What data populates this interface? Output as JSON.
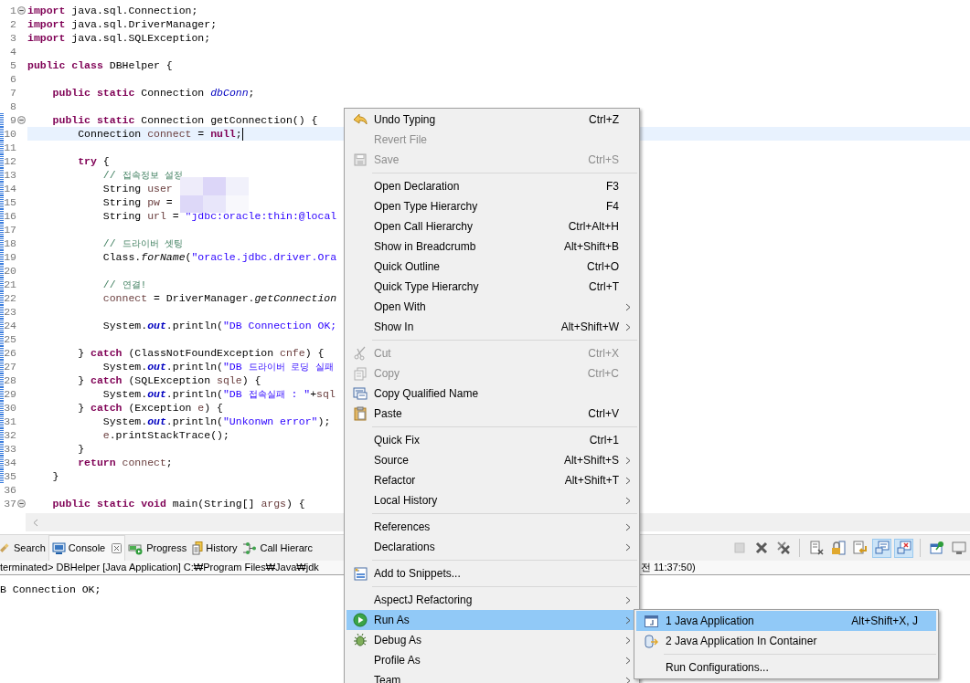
{
  "editor": {
    "lines": [
      {
        "n": "1",
        "fold": true,
        "current": false,
        "changed": false,
        "tokens": [
          {
            "kind": "keyword",
            "text": "import"
          },
          {
            "kind": "plain",
            "text": " java.sql.Connection;"
          }
        ]
      },
      {
        "n": "2",
        "fold": false,
        "current": false,
        "changed": false,
        "tokens": [
          {
            "kind": "keyword",
            "text": "import"
          },
          {
            "kind": "plain",
            "text": " java.sql.DriverManager;"
          }
        ]
      },
      {
        "n": "3",
        "fold": false,
        "current": false,
        "changed": false,
        "tokens": [
          {
            "kind": "keyword",
            "text": "import"
          },
          {
            "kind": "plain",
            "text": " java.sql.SQLException;"
          }
        ]
      },
      {
        "n": "4",
        "fold": false,
        "current": false,
        "changed": false
      },
      {
        "n": "5",
        "fold": false,
        "current": false,
        "changed": false,
        "tokens": [
          {
            "kind": "keyword",
            "text": "public "
          },
          {
            "kind": "keyword",
            "text": "class"
          },
          {
            "kind": "plain",
            "text": " DBHelper {"
          }
        ]
      },
      {
        "n": "6",
        "fold": false,
        "current": false,
        "changed": false
      },
      {
        "n": "7",
        "fold": false,
        "current": false,
        "changed": false,
        "tokens": [
          {
            "kind": "keyword",
            "text": "    public "
          },
          {
            "kind": "keyword",
            "text": "static"
          },
          {
            "kind": "plain",
            "text": " Connection "
          },
          {
            "kind": "field",
            "text": "dbConn"
          },
          {
            "kind": "plain",
            "text": ";"
          }
        ]
      },
      {
        "n": "8",
        "fold": false,
        "current": false,
        "changed": false
      },
      {
        "n": "9",
        "fold": true,
        "current": false,
        "changed": true,
        "tokens": [
          {
            "kind": "keyword",
            "text": "    public "
          },
          {
            "kind": "keyword",
            "text": "static"
          },
          {
            "kind": "plain",
            "text": " Connection getConnection() {"
          }
        ]
      },
      {
        "n": "10",
        "fold": false,
        "current": true,
        "changed": true,
        "tokens": [
          {
            "kind": "plain",
            "text": "        Connection "
          },
          {
            "kind": "var",
            "text": "connect"
          },
          {
            "kind": "plain",
            "text": " = "
          },
          {
            "kind": "keyword",
            "text": "null"
          },
          {
            "kind": "plain",
            "text": ";"
          }
        ]
      },
      {
        "n": "11",
        "fold": false,
        "current": false,
        "changed": true
      },
      {
        "n": "12",
        "fold": false,
        "current": false,
        "changed": true,
        "tokens": [
          {
            "kind": "keyword",
            "text": "        try"
          },
          {
            "kind": "plain",
            "text": " {"
          }
        ]
      },
      {
        "n": "13",
        "fold": false,
        "current": false,
        "changed": true,
        "tokens": [
          {
            "kind": "comment",
            "text": "            // 접속정보 설정"
          }
        ]
      },
      {
        "n": "14",
        "fold": false,
        "current": false,
        "changed": true,
        "tokens": [
          {
            "kind": "plain",
            "text": "            String "
          },
          {
            "kind": "var",
            "text": "user"
          }
        ]
      },
      {
        "n": "15",
        "fold": false,
        "current": false,
        "changed": true,
        "tokens": [
          {
            "kind": "plain",
            "text": "            String "
          },
          {
            "kind": "var",
            "text": "pw"
          },
          {
            "kind": "plain",
            "text": " ="
          }
        ]
      },
      {
        "n": "16",
        "fold": false,
        "current": false,
        "changed": true,
        "tokens": [
          {
            "kind": "plain",
            "text": "            String "
          },
          {
            "kind": "var",
            "text": "url"
          },
          {
            "kind": "plain",
            "text": " = "
          },
          {
            "kind": "string",
            "text": "\"jdbc:oracle:thin:@local"
          }
        ]
      },
      {
        "n": "17",
        "fold": false,
        "current": false,
        "changed": true
      },
      {
        "n": "18",
        "fold": false,
        "current": false,
        "changed": true,
        "tokens": [
          {
            "kind": "comment",
            "text": "            // 드라이버 셋팅"
          }
        ]
      },
      {
        "n": "19",
        "fold": false,
        "current": false,
        "changed": true,
        "tokens": [
          {
            "kind": "plain",
            "text": "            Class."
          },
          {
            "kind": "static-method",
            "text": "forName"
          },
          {
            "kind": "plain",
            "text": "("
          },
          {
            "kind": "string",
            "text": "\"oracle.jdbc.driver.Ora"
          }
        ]
      },
      {
        "n": "20",
        "fold": false,
        "current": false,
        "changed": true
      },
      {
        "n": "21",
        "fold": false,
        "current": false,
        "changed": true,
        "tokens": [
          {
            "kind": "comment",
            "text": "            // 연결!"
          }
        ]
      },
      {
        "n": "22",
        "fold": false,
        "current": false,
        "changed": true,
        "tokens": [
          {
            "kind": "var",
            "text": "            connect"
          },
          {
            "kind": "plain",
            "text": " = DriverManager."
          },
          {
            "kind": "static-method",
            "text": "getConnection"
          }
        ]
      },
      {
        "n": "23",
        "fold": false,
        "current": false,
        "changed": true
      },
      {
        "n": "24",
        "fold": false,
        "current": false,
        "changed": true,
        "tokens": [
          {
            "kind": "plain",
            "text": "            System."
          },
          {
            "kind": "static-field",
            "text": "out"
          },
          {
            "kind": "plain",
            "text": ".println("
          },
          {
            "kind": "string",
            "text": "\"DB Connection OK;"
          }
        ]
      },
      {
        "n": "25",
        "fold": false,
        "current": false,
        "changed": true
      },
      {
        "n": "26",
        "fold": false,
        "current": false,
        "changed": true,
        "tokens": [
          {
            "kind": "plain",
            "text": "        } "
          },
          {
            "kind": "keyword",
            "text": "catch"
          },
          {
            "kind": "plain",
            "text": " (ClassNotFoundException "
          },
          {
            "kind": "var",
            "text": "cnfe"
          },
          {
            "kind": "plain",
            "text": ") {"
          }
        ]
      },
      {
        "n": "27",
        "fold": false,
        "current": false,
        "changed": true,
        "tokens": [
          {
            "kind": "plain",
            "text": "            System."
          },
          {
            "kind": "static-field",
            "text": "out"
          },
          {
            "kind": "plain",
            "text": ".println("
          },
          {
            "kind": "string",
            "text": "\"DB 드라이버 로딩 실패"
          }
        ]
      },
      {
        "n": "28",
        "fold": false,
        "current": false,
        "changed": true,
        "tokens": [
          {
            "kind": "plain",
            "text": "        } "
          },
          {
            "kind": "keyword",
            "text": "catch"
          },
          {
            "kind": "plain",
            "text": " (SQLException "
          },
          {
            "kind": "var",
            "text": "sqle"
          },
          {
            "kind": "plain",
            "text": ") {"
          }
        ]
      },
      {
        "n": "29",
        "fold": false,
        "current": false,
        "changed": true,
        "tokens": [
          {
            "kind": "plain",
            "text": "            System."
          },
          {
            "kind": "static-field",
            "text": "out"
          },
          {
            "kind": "plain",
            "text": ".println("
          },
          {
            "kind": "string",
            "text": "\"DB 접속실패 : \""
          },
          {
            "kind": "plain",
            "text": "+"
          },
          {
            "kind": "var",
            "text": "sql"
          }
        ]
      },
      {
        "n": "30",
        "fold": false,
        "current": false,
        "changed": true,
        "tokens": [
          {
            "kind": "plain",
            "text": "        } "
          },
          {
            "kind": "keyword",
            "text": "catch"
          },
          {
            "kind": "plain",
            "text": " (Exception "
          },
          {
            "kind": "var",
            "text": "e"
          },
          {
            "kind": "plain",
            "text": ") {"
          }
        ]
      },
      {
        "n": "31",
        "fold": false,
        "current": false,
        "changed": true,
        "tokens": [
          {
            "kind": "plain",
            "text": "            System."
          },
          {
            "kind": "static-field",
            "text": "out"
          },
          {
            "kind": "plain",
            "text": ".println("
          },
          {
            "kind": "string",
            "text": "\"Unkonwn error\""
          },
          {
            "kind": "plain",
            "text": ");"
          }
        ]
      },
      {
        "n": "32",
        "fold": false,
        "current": false,
        "changed": true,
        "tokens": [
          {
            "kind": "var",
            "text": "            e"
          },
          {
            "kind": "plain",
            "text": ".printStackTrace();"
          }
        ]
      },
      {
        "n": "33",
        "fold": false,
        "current": false,
        "changed": true,
        "tokens": [
          {
            "kind": "plain",
            "text": "        }"
          }
        ]
      },
      {
        "n": "34",
        "fold": false,
        "current": false,
        "changed": true,
        "tokens": [
          {
            "kind": "keyword",
            "text": "        return "
          },
          {
            "kind": "var",
            "text": "connect"
          },
          {
            "kind": "plain",
            "text": ";"
          }
        ]
      },
      {
        "n": "35",
        "fold": false,
        "current": false,
        "changed": true,
        "tokens": [
          {
            "kind": "plain",
            "text": "    }"
          }
        ]
      },
      {
        "n": "36",
        "fold": false,
        "current": false,
        "changed": false
      },
      {
        "n": "37",
        "fold": true,
        "current": false,
        "changed": false,
        "tokens": [
          {
            "kind": "keyword",
            "text": "    public "
          },
          {
            "kind": "keyword",
            "text": "static "
          },
          {
            "kind": "keyword",
            "text": "void"
          },
          {
            "kind": "plain",
            "text": " main(String[] "
          },
          {
            "kind": "var",
            "text": "args"
          },
          {
            "kind": "plain",
            "text": ") {"
          }
        ]
      }
    ]
  },
  "views": {
    "tabs": [
      {
        "kind": "search",
        "label": "Search",
        "selected": false,
        "closable": false
      },
      {
        "kind": "console",
        "label": "Console",
        "selected": true,
        "closable": true
      },
      {
        "kind": "progress",
        "label": "Progress",
        "selected": false,
        "closable": false
      },
      {
        "kind": "history",
        "label": "History",
        "selected": false,
        "closable": false
      },
      {
        "kind": "call-hierarchy",
        "label": "Call Hierarc",
        "selected": false,
        "closable": false
      }
    ],
    "toolbar": [
      {
        "kind": "stop",
        "disabled": true,
        "pressed": false
      },
      {
        "kind": "remove",
        "disabled": false,
        "pressed": false
      },
      {
        "kind": "remove-all",
        "disabled": false,
        "pressed": false
      },
      {
        "kind": "separator"
      },
      {
        "kind": "clear",
        "disabled": false,
        "pressed": false
      },
      {
        "kind": "scroll-lock",
        "disabled": false,
        "pressed": false
      },
      {
        "kind": "word-wrap",
        "disabled": false,
        "pressed": false
      },
      {
        "kind": "stdout",
        "disabled": false,
        "pressed": true
      },
      {
        "kind": "stderr",
        "disabled": false,
        "pressed": true
      },
      {
        "kind": "separator"
      },
      {
        "kind": "pin",
        "disabled": false,
        "pressed": false
      },
      {
        "kind": "display",
        "disabled": false,
        "pressed": false
      }
    ]
  },
  "console": {
    "header": "terminated> DBHelper [Java Application] C:₩Program Files₩Java₩jdk",
    "header_end": "전 11:37:50)",
    "output": "B Connection OK;"
  },
  "menu": [
    {
      "kind": "item",
      "label": "Undo Typing",
      "shortcut": "Ctrl+Z",
      "submenu": false,
      "disabled": false,
      "selected": false
    },
    {
      "kind": "item",
      "label": "Revert File",
      "submenu": false,
      "disabled": true,
      "selected": false
    },
    {
      "kind": "item",
      "label": "Save",
      "shortcut": "Ctrl+S",
      "submenu": false,
      "disabled": true,
      "selected": false
    },
    {
      "kind": "separator"
    },
    {
      "kind": "item",
      "label": "Open Declaration",
      "shortcut": "F3",
      "submenu": false,
      "disabled": false,
      "selected": false
    },
    {
      "kind": "item",
      "label": "Open Type Hierarchy",
      "shortcut": "F4",
      "submenu": false,
      "disabled": false,
      "selected": false
    },
    {
      "kind": "item",
      "label": "Open Call Hierarchy",
      "shortcut": "Ctrl+Alt+H",
      "submenu": false,
      "disabled": false,
      "selected": false
    },
    {
      "kind": "item",
      "label": "Show in Breadcrumb",
      "shortcut": "Alt+Shift+B",
      "submenu": false,
      "disabled": false,
      "selected": false
    },
    {
      "kind": "item",
      "label": "Quick Outline",
      "shortcut": "Ctrl+O",
      "submenu": false,
      "disabled": false,
      "selected": false
    },
    {
      "kind": "item",
      "label": "Quick Type Hierarchy",
      "shortcut": "Ctrl+T",
      "submenu": false,
      "disabled": false,
      "selected": false
    },
    {
      "kind": "item",
      "label": "Open With",
      "submenu": true,
      "disabled": false,
      "selected": false
    },
    {
      "kind": "item",
      "label": "Show In",
      "shortcut": "Alt+Shift+W",
      "submenu": true,
      "disabled": false,
      "selected": false
    },
    {
      "kind": "separator"
    },
    {
      "kind": "item",
      "label": "Cut",
      "shortcut": "Ctrl+X",
      "submenu": false,
      "disabled": true,
      "selected": false
    },
    {
      "kind": "item",
      "label": "Copy",
      "shortcut": "Ctrl+C",
      "submenu": false,
      "disabled": true,
      "selected": false
    },
    {
      "kind": "item",
      "label": "Copy Qualified Name",
      "submenu": false,
      "disabled": false,
      "selected": false
    },
    {
      "kind": "item",
      "label": "Paste",
      "shortcut": "Ctrl+V",
      "submenu": false,
      "disabled": false,
      "selected": false
    },
    {
      "kind": "separator"
    },
    {
      "kind": "item",
      "label": "Quick Fix",
      "shortcut": "Ctrl+1",
      "submenu": false,
      "disabled": false,
      "selected": false
    },
    {
      "kind": "item",
      "label": "Source",
      "shortcut": "Alt+Shift+S",
      "submenu": true,
      "disabled": false,
      "selected": false
    },
    {
      "kind": "item",
      "label": "Refactor",
      "shortcut": "Alt+Shift+T",
      "submenu": true,
      "disabled": false,
      "selected": false
    },
    {
      "kind": "item",
      "label": "Local History",
      "submenu": true,
      "disabled": false,
      "selected": false
    },
    {
      "kind": "separator"
    },
    {
      "kind": "item",
      "label": "References",
      "submenu": true,
      "disabled": false,
      "selected": false
    },
    {
      "kind": "item",
      "label": "Declarations",
      "submenu": true,
      "disabled": false,
      "selected": false
    },
    {
      "kind": "separator"
    },
    {
      "kind": "item",
      "label": "Add to Snippets...",
      "submenu": false,
      "disabled": false,
      "selected": false
    },
    {
      "kind": "separator"
    },
    {
      "kind": "item",
      "label": "AspectJ Refactoring",
      "submenu": true,
      "disabled": false,
      "selected": false
    },
    {
      "kind": "item",
      "label": "Run As",
      "submenu": true,
      "disabled": false,
      "selected": true
    },
    {
      "kind": "item",
      "label": "Debug As",
      "submenu": true,
      "disabled": false,
      "selected": false
    },
    {
      "kind": "item",
      "label": "Profile As",
      "submenu": true,
      "disabled": false,
      "selected": false
    },
    {
      "kind": "item",
      "label": "Team",
      "submenu": true,
      "disabled": false,
      "selected": false
    }
  ],
  "submenu": [
    {
      "kind": "item",
      "label": "1 Java Application",
      "shortcut": "Alt+Shift+X, J",
      "selected": true
    },
    {
      "kind": "item",
      "label": "2 Java Application In Container",
      "selected": false
    },
    {
      "kind": "separator"
    },
    {
      "kind": "item",
      "label": "Run Configurations...",
      "selected": false
    }
  ]
}
